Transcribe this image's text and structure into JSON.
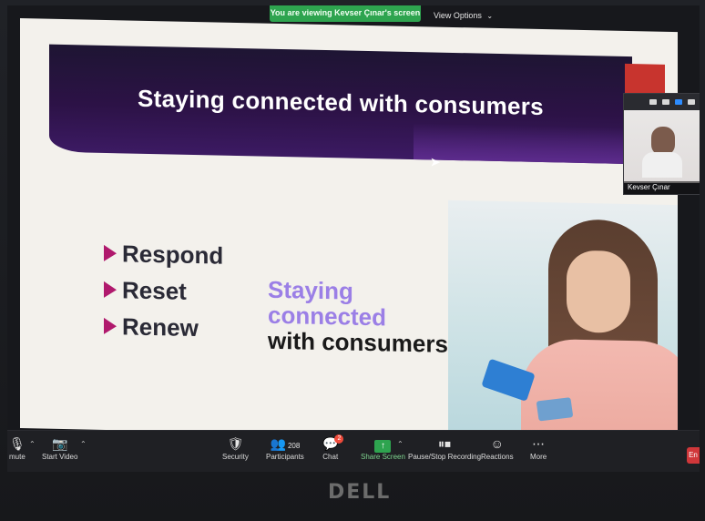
{
  "banner": {
    "viewing_text": "You are viewing Kevser Çınar's screen"
  },
  "view_options": {
    "label": "View Options",
    "caret": "⌄"
  },
  "slide": {
    "title": "Staying connected with consumers",
    "bullets": [
      "Respond",
      "Reset",
      "Renew"
    ],
    "headline": {
      "line1": "Staying",
      "line2": "connected",
      "line3": "with consumers"
    }
  },
  "video_thumbnail": {
    "name": "Kevser Çınar"
  },
  "toolbar": {
    "mute": "mute",
    "start_video": "Start Video",
    "security": "Security",
    "participants_label": "Participants",
    "participants_count": "208",
    "chat": "Chat",
    "chat_badge": "2",
    "share_screen": "Share Screen",
    "pause_stop_recording": "Pause/Stop Recording",
    "reactions": "Reactions",
    "more": "More",
    "end": "En"
  },
  "monitor": {
    "brand": "DELL"
  },
  "colors": {
    "banner_green": "#2ea44f",
    "header_purple": "#2c1246",
    "accent_red": "#c8342e",
    "bullet_triangle": "#b0196d",
    "headline_purple": "#9b7fe6"
  }
}
